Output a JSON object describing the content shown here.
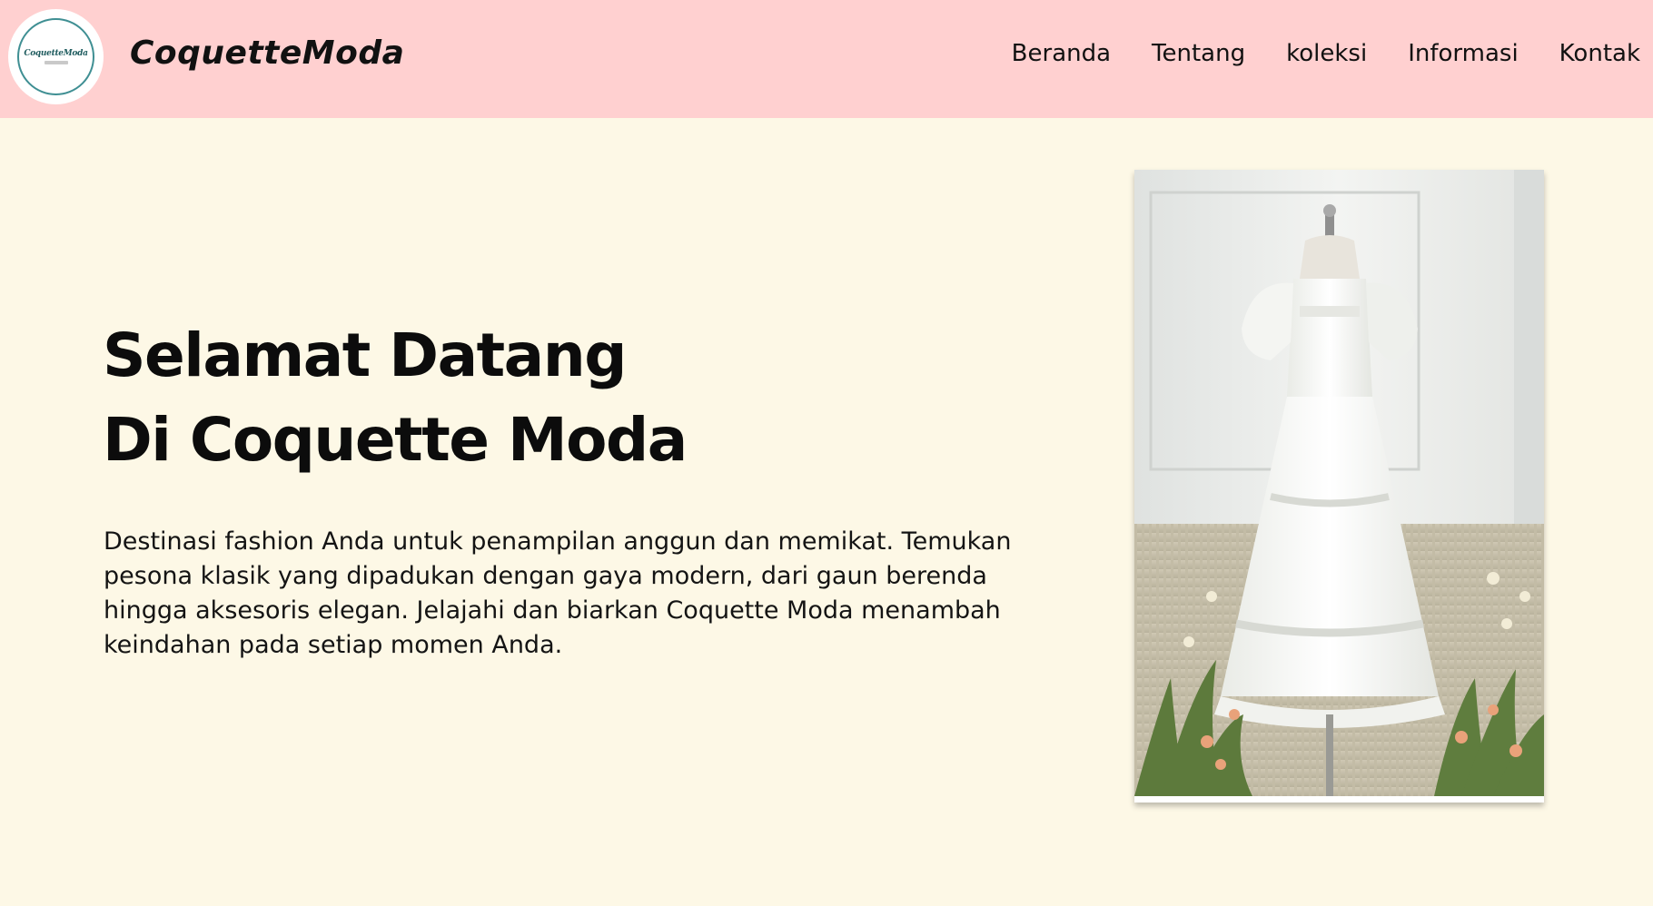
{
  "header": {
    "logo": {
      "name": "CoquetteModa",
      "icon": "logo-icon"
    },
    "brand": "CoquetteModa",
    "nav": [
      {
        "label": "Beranda"
      },
      {
        "label": "Tentang"
      },
      {
        "label": "koleksi"
      },
      {
        "label": "Informasi"
      },
      {
        "label": "Kontak"
      }
    ]
  },
  "hero": {
    "title_line1": "Selamat Datang",
    "title_line2": "Di Coquette Moda",
    "description": "Destinasi fashion Anda untuk penampilan anggun dan memikat. Temukan pesona klasik yang dipadukan dengan gaya modern, dari gaun berenda hingga aksesoris elegan. Jelajahi dan biarkan Coquette Moda menambah keindahan pada setiap momen Anda.",
    "image": {
      "icon": "white-dress-photo"
    }
  },
  "colors": {
    "header_bg": "#ffd0d0",
    "page_bg": "#fdf8e6",
    "logo_ring": "#3f8f93"
  }
}
